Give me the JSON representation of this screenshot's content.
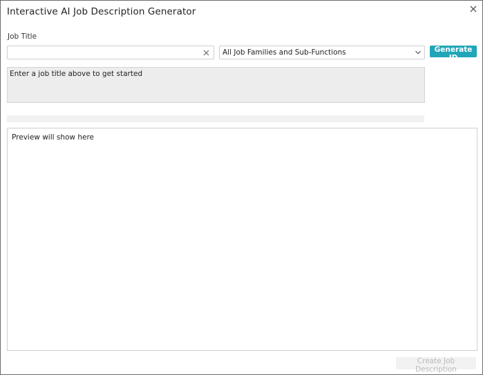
{
  "dialog": {
    "title": "Interactive AI Job Description Generator",
    "close_icon": "close-icon"
  },
  "form": {
    "job_title_label": "Job Title",
    "job_title_value": "",
    "clear_icon": "clear-icon",
    "job_family_select": {
      "selected": "All Job Families and Sub-Functions",
      "icon": "chevron-down-icon"
    },
    "generate_label": "Generate JD"
  },
  "hint": {
    "text": "Enter a job title above to get started"
  },
  "progress": {
    "percent": 0
  },
  "preview": {
    "placeholder": "Preview will show here"
  },
  "footer": {
    "create_label": "Create Job Description",
    "create_enabled": false
  },
  "colors": {
    "accent": "#21a6b8",
    "hint_bg": "#ededed",
    "disabled_text": "#b9b9b9"
  }
}
